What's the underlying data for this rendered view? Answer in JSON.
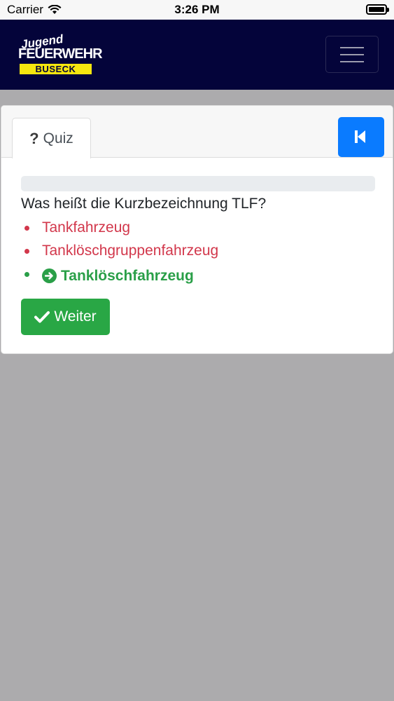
{
  "status_bar": {
    "carrier": "Carrier",
    "time": "3:26 PM"
  },
  "header": {
    "logo": {
      "line1": "Jugend",
      "line2": "FEUERWEHR",
      "line3": "BUSECK"
    },
    "colors": {
      "navbar_bg": "#04043a",
      "logo_yellow": "#f6e60f"
    }
  },
  "card": {
    "tab_label": "Quiz",
    "tab_icon": "question-mark-icon",
    "back_button_icon": "skip-back-icon",
    "progress_fraction": 0.0,
    "question": "Was heißt die Kurzbezeichnung TLF?",
    "answers": [
      {
        "label": "Tankfahrzeug",
        "state": "wrong"
      },
      {
        "label": "Tanklöschgruppenfahrzeug",
        "state": "wrong"
      },
      {
        "label": "Tanklöschfahrzeug",
        "state": "correct"
      }
    ],
    "next_button_label": "Weiter",
    "next_button_icon": "checkmark-icon"
  },
  "colors": {
    "primary": "#0a7bff",
    "success": "#29a745",
    "danger": "#d2374b",
    "background": "#acabad"
  }
}
